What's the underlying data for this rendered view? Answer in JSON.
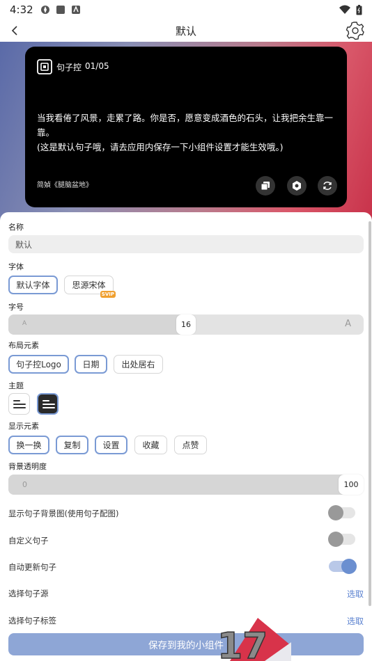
{
  "status_bar": {
    "time": "4:32"
  },
  "header": {
    "title": "默认"
  },
  "widget": {
    "brand": "句子控",
    "date": "01/05",
    "quote_line1": "当我看倦了风景，走累了路。你是否，愿意变成酒色的石头，让我把余生靠一靠。",
    "quote_line2": "(这是默认句子哦，请去应用内保存一下小组件设置才能生效哦。)",
    "source": "简媜《腿脑盆地》"
  },
  "form": {
    "name_label": "名称",
    "name_value": "默认",
    "font_label": "字体",
    "font_options": [
      "默认字体",
      "思源宋体"
    ],
    "font_badge": "SVIP",
    "size_label": "字号",
    "size_min": "A",
    "size_max": "A",
    "size_value": "16",
    "layout_label": "布局元素",
    "layout_options": [
      "句子控Logo",
      "日期",
      "出处居右"
    ],
    "theme_label": "主题",
    "display_label": "显示元素",
    "display_options": [
      "换一换",
      "复制",
      "设置",
      "收藏",
      "点赞"
    ],
    "opacity_label": "背景透明度",
    "opacity_min": "0",
    "opacity_value": "100",
    "show_bg_label": "显示句子背景图(使用句子配图)",
    "custom_label": "自定义句子",
    "auto_update_label": "自动更新句子",
    "source_label": "选择句子源",
    "source_link": "选取",
    "tag_label": "选择句子标签",
    "tag_link": "选取",
    "save_label": "保存到我的小组件"
  },
  "state": {
    "font_size_fraction": 0.5,
    "opacity_percent": 100,
    "show_bg_on": false,
    "custom_on": false,
    "auto_update_on": true
  },
  "colors": {
    "accent": "#7a9ad4",
    "link": "#5b82d0",
    "save_button": "#8ea6d6"
  },
  "overlay_logo_text": "17"
}
